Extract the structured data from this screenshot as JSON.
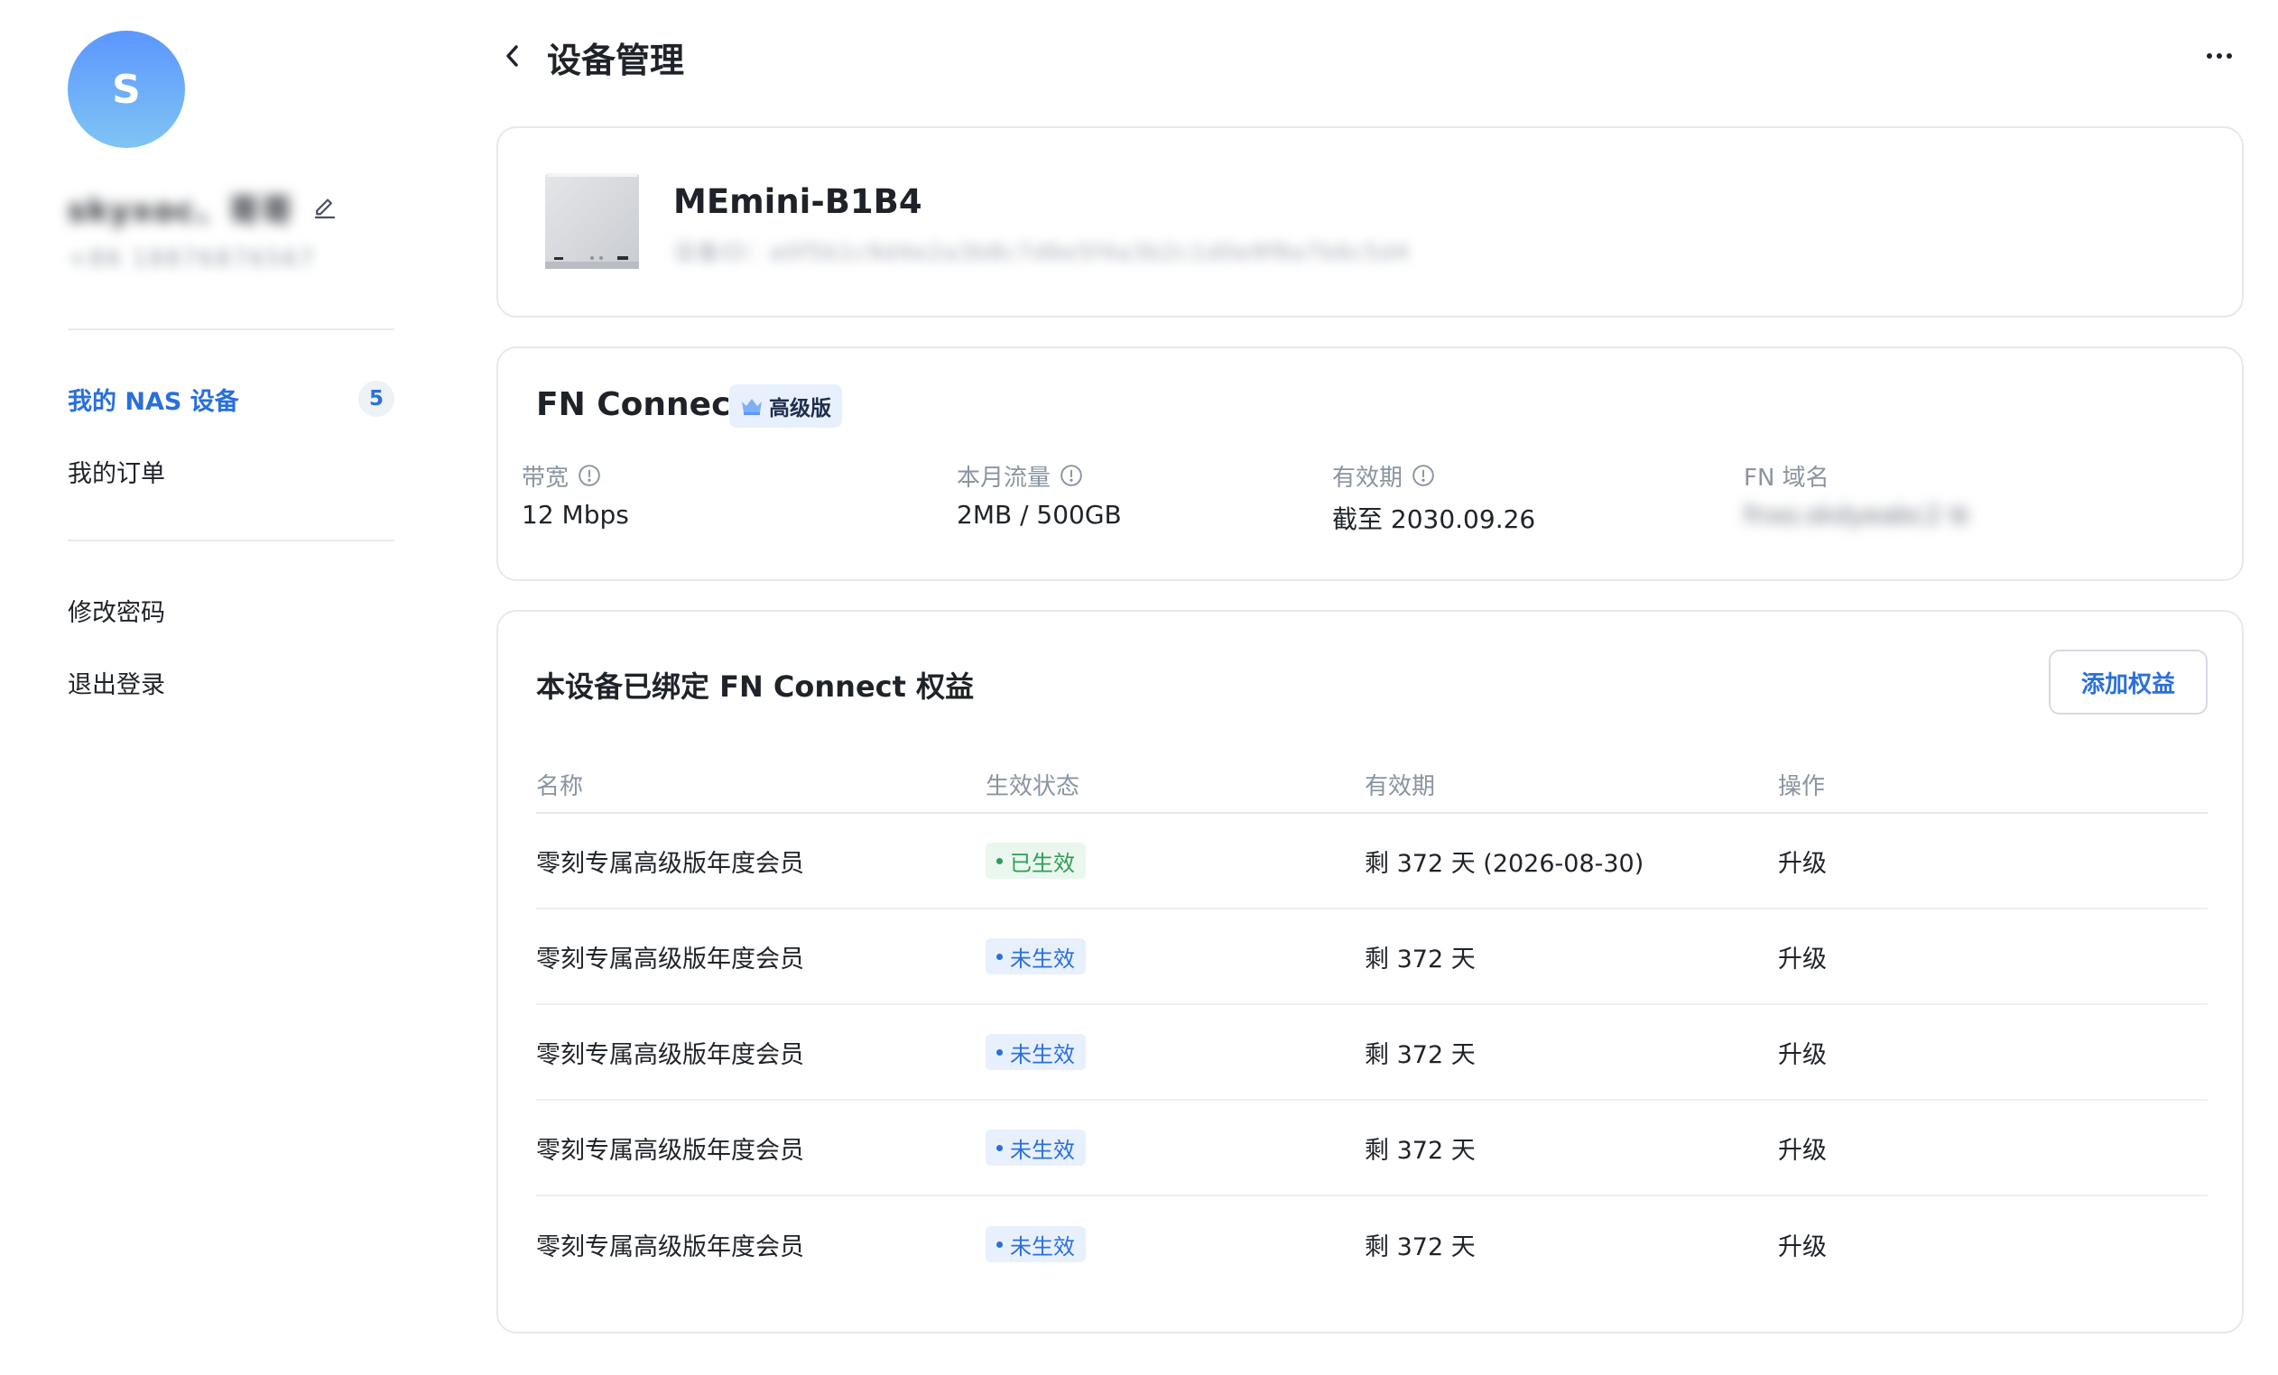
{
  "sidebar": {
    "avatar_letter": "S",
    "user_name": "skyxoc、哥哥",
    "user_account": "+86 18876876567",
    "nav": [
      {
        "label": "我的 NAS 设备",
        "badge": "5"
      },
      {
        "label": "我的订单"
      }
    ],
    "actions": [
      {
        "label": "修改密码"
      },
      {
        "label": "退出登录"
      }
    ]
  },
  "header": {
    "title": "设备管理"
  },
  "device": {
    "name": "MEmini-B1B4",
    "serial": "设备ID：a0f5b1c9d4e2a3b8c7d6e5f4a3b2c1d0e9f8a7b6c5d4"
  },
  "connect": {
    "title": "FN Connect",
    "plan_badge": "高级版",
    "stats": [
      {
        "label": "带宽",
        "value": "12 Mbps"
      },
      {
        "label": "本月流量",
        "value": "2MB / 500GB"
      },
      {
        "label": "有效期",
        "value": "截至 2030.09.26"
      },
      {
        "label": "FN 域名",
        "value": "fnxo.skdyeabc2 ⧉"
      }
    ]
  },
  "rights": {
    "title": "本设备已绑定 FN Connect 权益",
    "add_button": "添加权益",
    "columns": [
      "名称",
      "生效状态",
      "有效期",
      "操作"
    ],
    "rows": [
      {
        "name": "零刻专属高级版年度会员",
        "status": "已生效",
        "validity": "剩 372 天 (2026-08-30)",
        "action": "升级"
      },
      {
        "name": "零刻专属高级版年度会员",
        "status": "未生效",
        "validity": "剩 372 天",
        "action": "升级"
      },
      {
        "name": "零刻专属高级版年度会员",
        "status": "未生效",
        "validity": "剩 372 天",
        "action": "升级"
      },
      {
        "name": "零刻专属高级版年度会员",
        "status": "未生效",
        "validity": "剩 372 天",
        "action": "升级"
      },
      {
        "name": "零刻专属高级版年度会员",
        "status": "未生效",
        "validity": "剩 372 天",
        "action": "升级"
      }
    ]
  },
  "colors": {
    "accent": "#2a6fdb",
    "active_status": "#2f9e55",
    "avatar_gradient_top": "#5b97ff",
    "avatar_gradient_bottom": "#7fc4f4"
  },
  "icons": [
    "edit-icon",
    "back-chevron-icon",
    "more-icon",
    "crown-icon",
    "info-icon"
  ]
}
